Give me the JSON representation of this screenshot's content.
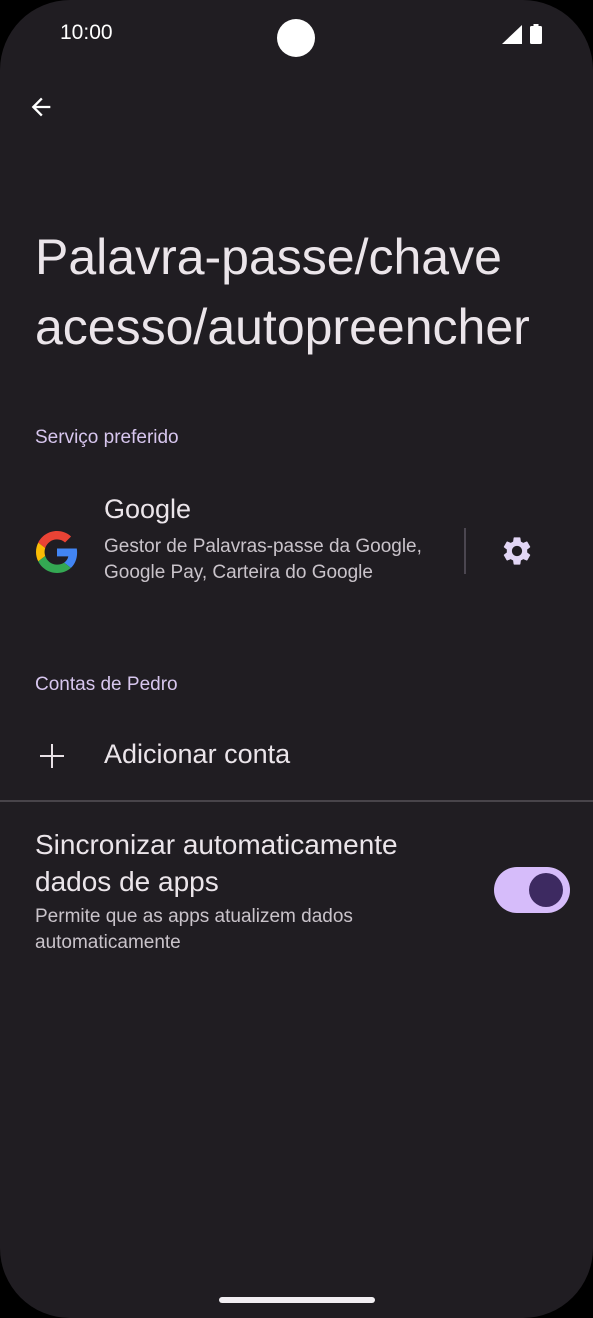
{
  "status_bar": {
    "time": "10:00"
  },
  "page": {
    "title": "Palavra-passe/chave acesso/autopreencher"
  },
  "preferred_service": {
    "header": "Serviço preferido",
    "name": "Google",
    "description": "Gestor de Palavras-passe da Google, Google Pay, Carteira do Google"
  },
  "accounts": {
    "header": "Contas de Pedro",
    "add_account_label": "Adicionar conta"
  },
  "sync": {
    "title": "Sincronizar automaticamente dados de apps",
    "description": "Permite que as apps atualizem dados automaticamente",
    "enabled": true
  },
  "colors": {
    "background": "#201d22",
    "accent": "#d6bcfa",
    "section_header": "#d7c6ee"
  },
  "icons": [
    "back-arrow-icon",
    "google-icon",
    "settings-gear-icon",
    "plus-icon",
    "signal-icon",
    "battery-icon"
  ]
}
